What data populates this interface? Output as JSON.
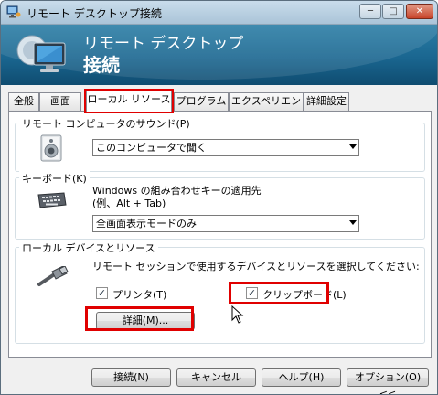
{
  "window": {
    "title": "リモート デスクトップ接続",
    "banner_line1": "リモート デスクトップ",
    "banner_line2": "接続",
    "caption": {
      "minimize": "─",
      "maximize": "□",
      "close": "✕"
    }
  },
  "tabs": [
    {
      "label": "全般",
      "active": false
    },
    {
      "label": "画面",
      "active": false
    },
    {
      "label": "ローカル リソース",
      "active": true
    },
    {
      "label": "プログラム",
      "active": false
    },
    {
      "label": "エクスペリエンス",
      "active": false
    },
    {
      "label": "詳細設定",
      "active": false
    }
  ],
  "sound": {
    "legend": "リモート コンピュータのサウンド(P)",
    "selected": "このコンピュータで聞く",
    "icon": "speaker-icon"
  },
  "keyboard": {
    "legend": "キーボード(K)",
    "description_line1": "Windows の組み合わせキーの適用先",
    "description_line2": "(例、Alt + Tab)",
    "selected": "全画面表示モードのみ",
    "icon": "keyboard-icon"
  },
  "local_devices": {
    "legend": "ローカル デバイスとリソース",
    "description": "リモート セッションで使用するデバイスとリソースを選択してください:",
    "printers_label": "プリンタ(T)",
    "printers_checked": true,
    "clipboard_label": "クリップボード(L)",
    "clipboard_checked": true,
    "details_button": "詳細(M)...",
    "icon": "usb-plug-icon"
  },
  "footer": {
    "connect": "接続(N)",
    "cancel": "キャンセル",
    "help": "ヘルプ(H)",
    "options": "オプション(O) <<"
  },
  "colors": {
    "highlight": "#e00000",
    "banner": "#1a6690"
  }
}
